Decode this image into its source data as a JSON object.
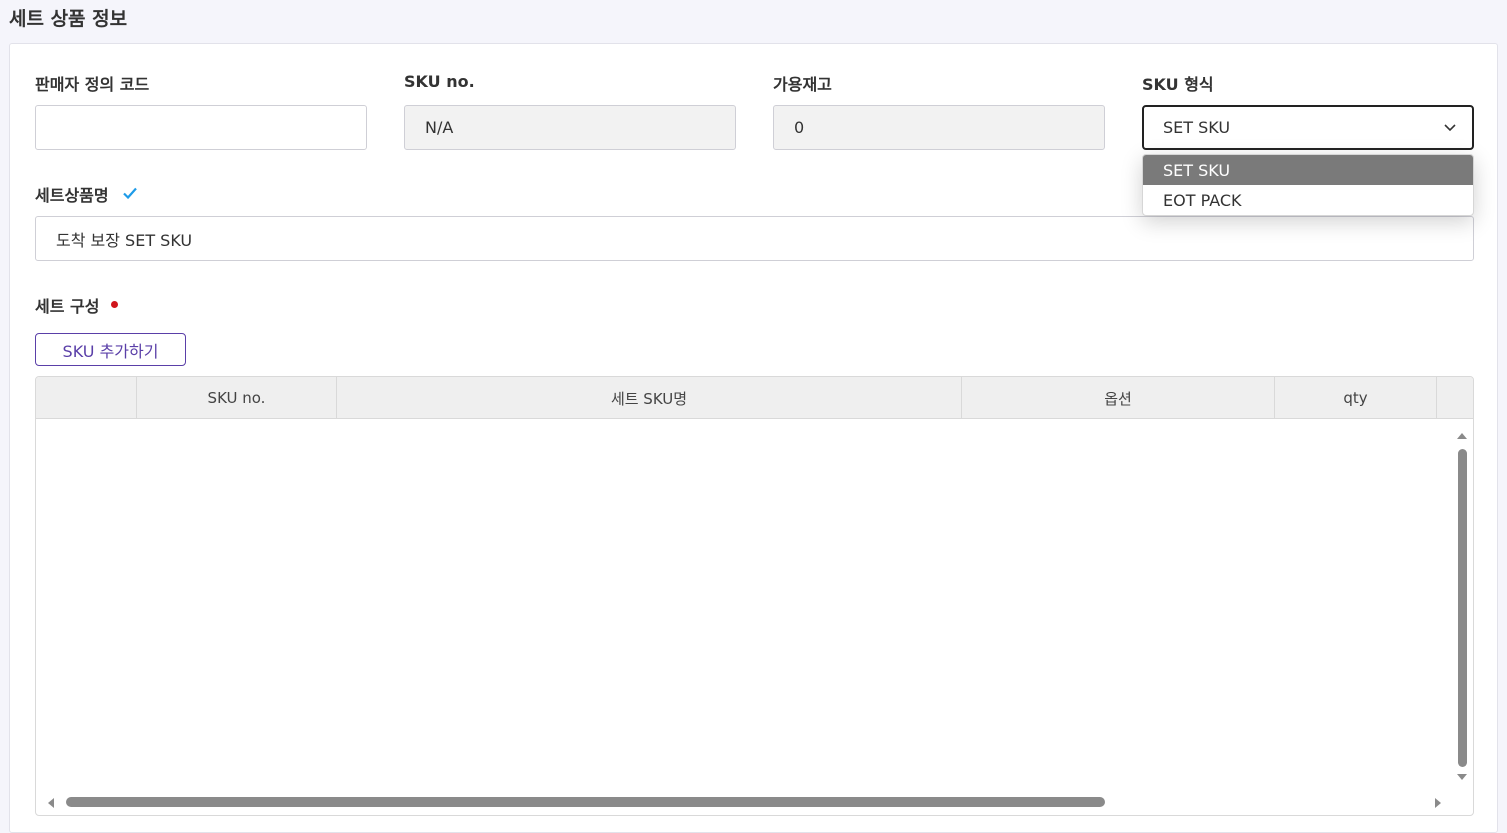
{
  "page": {
    "title": "세트 상품 정보"
  },
  "fields": {
    "seller_code": {
      "label": "판매자 정의 코드",
      "value": ""
    },
    "sku_no": {
      "label": "SKU no.",
      "value": "N/A"
    },
    "available_stock": {
      "label": "가용재고",
      "value": "0"
    },
    "sku_type": {
      "label": "SKU 형식",
      "value": "SET SKU",
      "options": [
        "SET SKU",
        "EOT PACK"
      ]
    },
    "set_name": {
      "label": "세트상품명",
      "value": "도착 보장 SET SKU"
    },
    "set_composition": {
      "label": "세트 구성"
    }
  },
  "buttons": {
    "add_sku": "SKU 추가하기"
  },
  "table": {
    "columns": [
      "",
      "SKU no.",
      "세트 SKU명",
      "옵션",
      "qty",
      ""
    ],
    "rows": []
  },
  "colors": {
    "accent": "#5a3fa8",
    "check": "#1e9be8",
    "required": "#d0161c",
    "selected_option_bg": "#7a7a7a"
  }
}
